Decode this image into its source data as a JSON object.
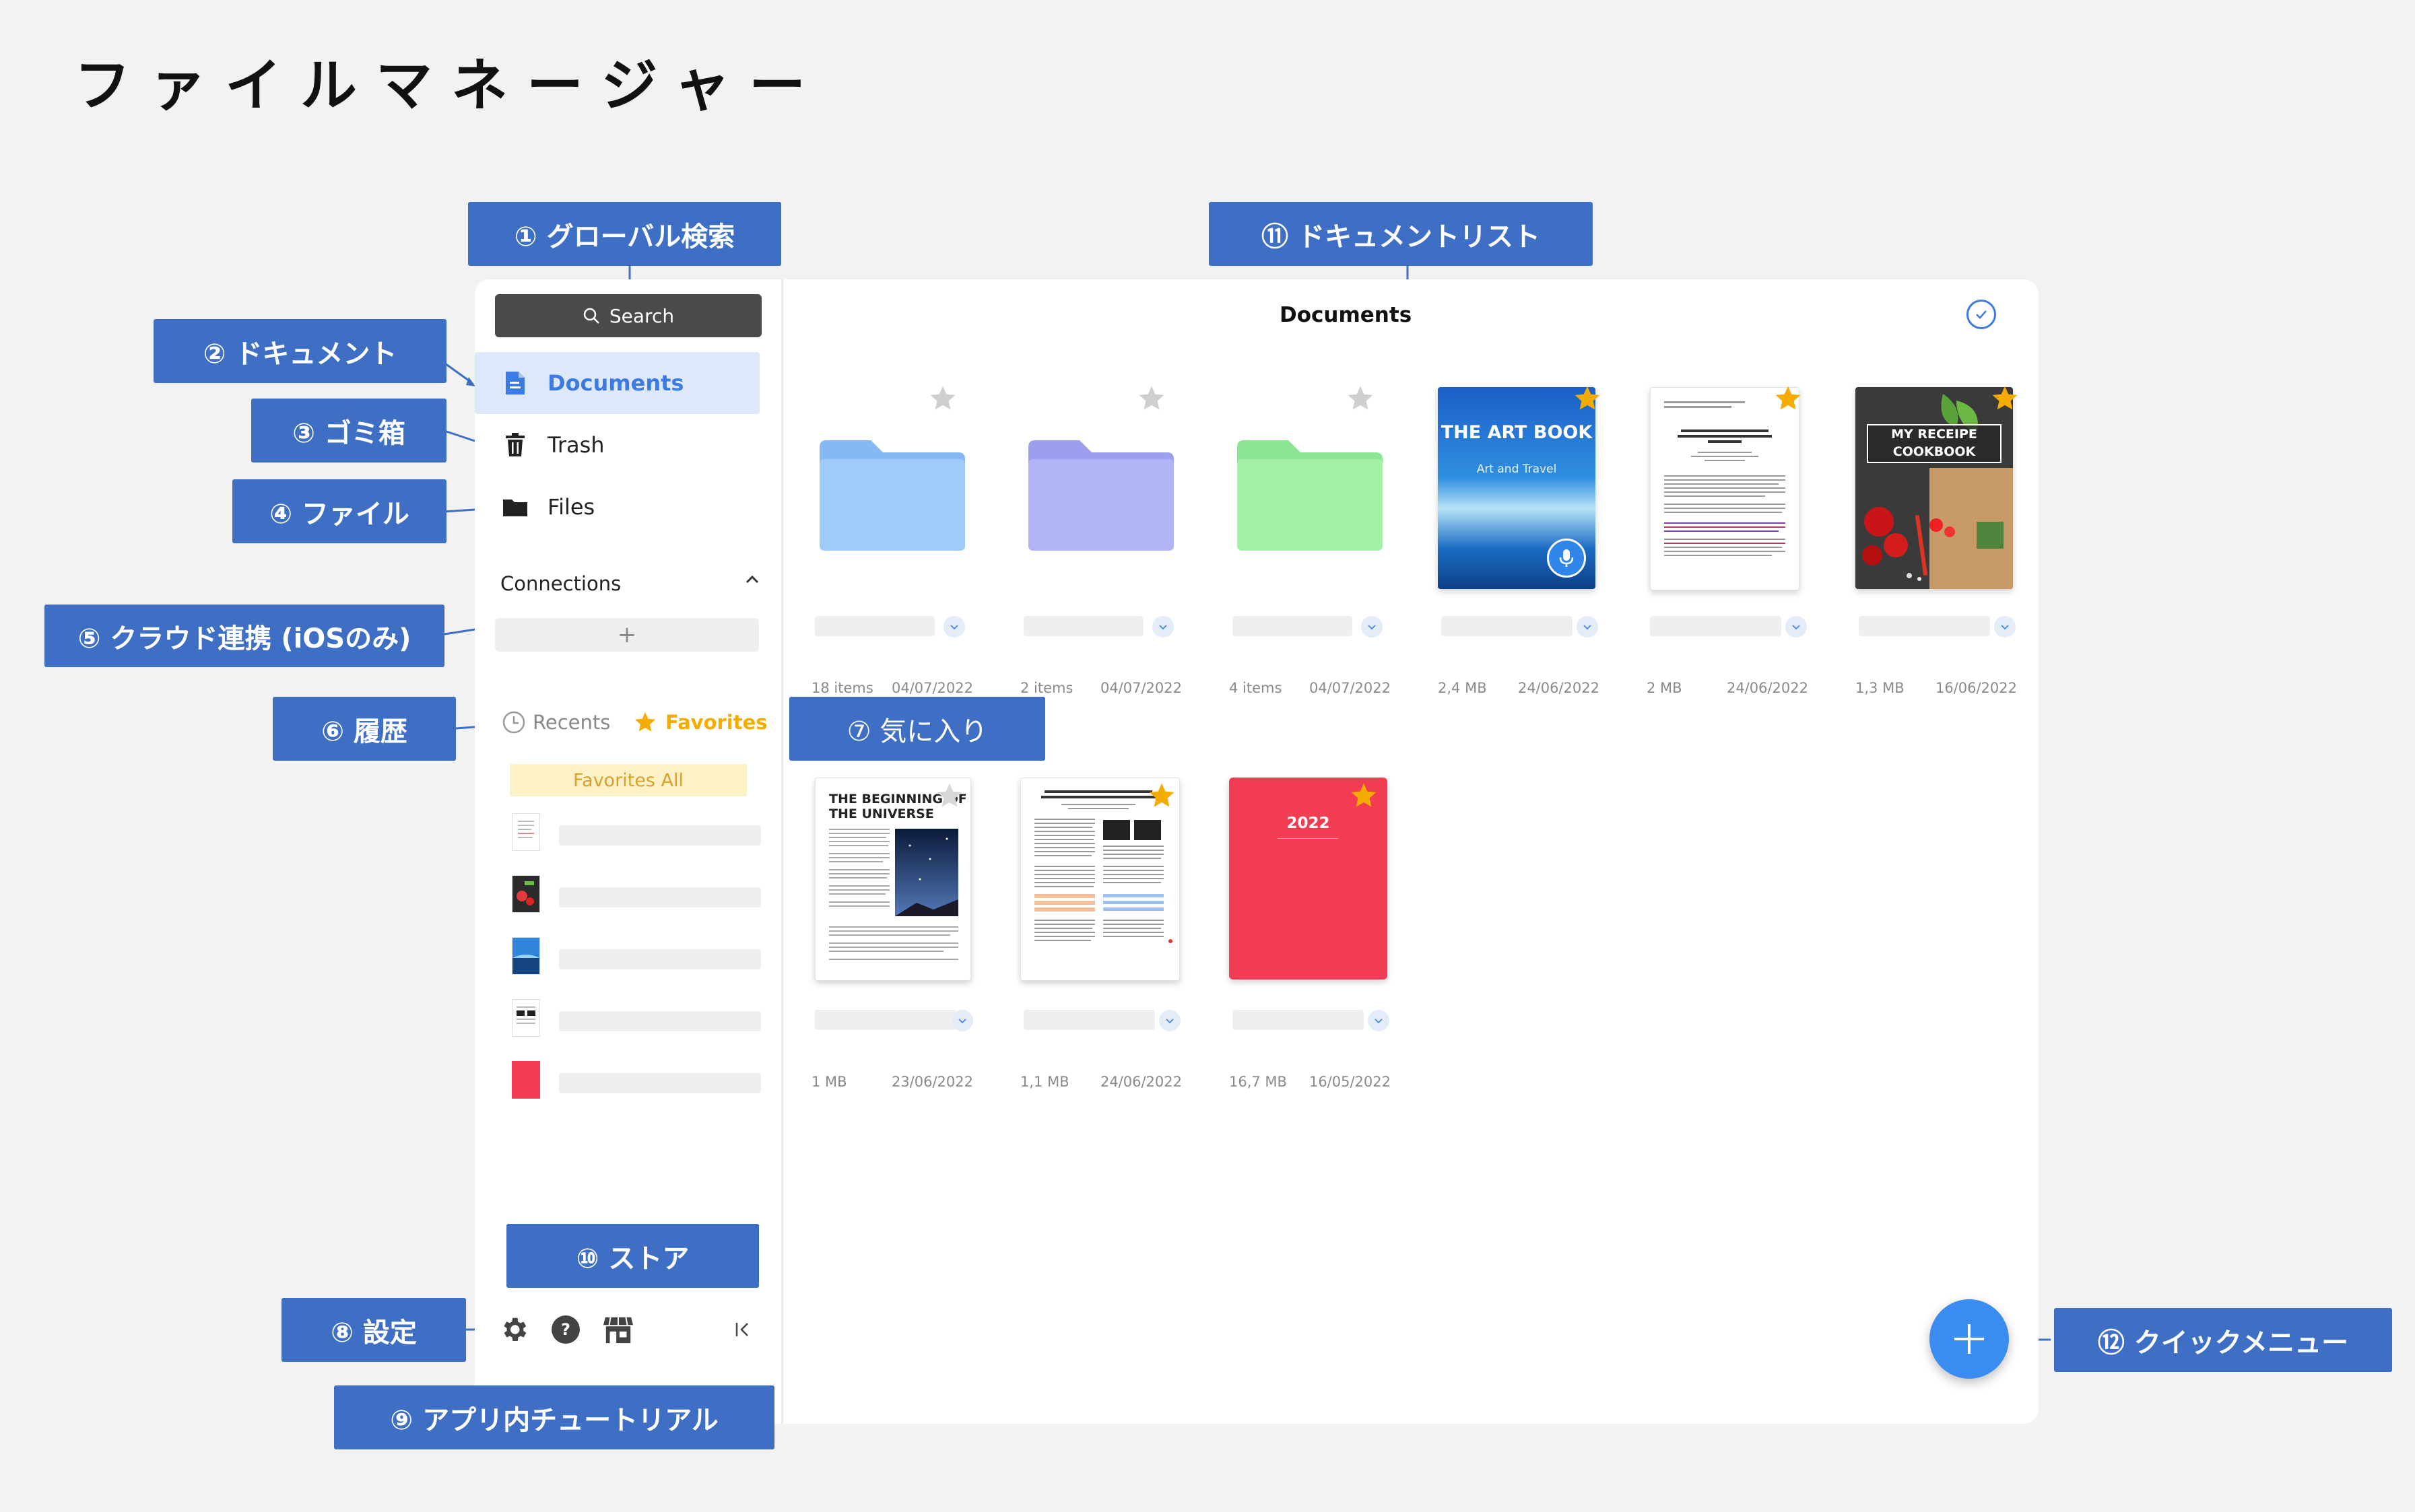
{
  "page_title": "ファイルマネージャー",
  "sidebar": {
    "search_label": "Search",
    "nav": [
      {
        "label": "Documents",
        "icon": "document-icon"
      },
      {
        "label": "Trash",
        "icon": "trash-icon"
      },
      {
        "label": "Files",
        "icon": "folder-icon"
      }
    ],
    "connections_label": "Connections",
    "add_connection": "+",
    "tabs": {
      "recents": "Recents",
      "favorites": "Favorites"
    },
    "favorites_all": "Favorites All"
  },
  "documents": {
    "title": "Documents",
    "items": [
      {
        "type": "folder",
        "color": "#9fcbfb",
        "meta_left": "18 items",
        "meta_right": "04/07/2022",
        "favorite": false
      },
      {
        "type": "folder",
        "color": "#b3b4f6",
        "meta_left": "2 items",
        "meta_right": "04/07/2022",
        "favorite": false
      },
      {
        "type": "folder",
        "color": "#a4f0a9",
        "meta_left": "4 items",
        "meta_right": "04/07/2022",
        "favorite": false
      },
      {
        "type": "book",
        "title": "THE ART BOOK",
        "subtitle": "Art and Travel",
        "meta_left": "2,4 MB",
        "meta_right": "24/06/2022",
        "favorite": true
      },
      {
        "type": "paper",
        "meta_left": "2 MB",
        "meta_right": "24/06/2022",
        "favorite": true
      },
      {
        "type": "cookbook",
        "title_line1": "MY RECEIPE",
        "title_line2": "COOKBOOK",
        "meta_left": "1,3 MB",
        "meta_right": "16/06/2022",
        "favorite": true
      },
      {
        "type": "universe",
        "title_line1": "THE BEGINNING OF",
        "title_line2": "THE UNIVERSE",
        "meta_left": "1 MB",
        "meta_right": "23/06/2022",
        "favorite": false
      },
      {
        "type": "paper2",
        "meta_left": "1,1 MB",
        "meta_right": "24/06/2022",
        "favorite": true
      },
      {
        "type": "notebook",
        "title": "2022",
        "meta_left": "16,7 MB",
        "meta_right": "16/05/2022",
        "favorite": true
      }
    ]
  },
  "callouts": {
    "c1": "① グローバル検索",
    "c2": "② ドキュメント",
    "c3": "③ ゴミ箱",
    "c4": "④ ファイル",
    "c5": "⑤ クラウド連携 (iOSのみ)",
    "c6": "⑥ 履歴",
    "c7": "⑦ 気に入り",
    "c8": "⑧ 設定",
    "c9": "⑨ アプリ内チュートリアル",
    "c10": "⑩ ストア",
    "c11": "⑪ ドキュメントリスト",
    "c12": "⑫ クイックメニュー"
  },
  "colors": {
    "accent": "#3c7be3",
    "callout": "#3e6fc5",
    "favorite": "#f4ac00",
    "fab": "#3b8cf0"
  }
}
